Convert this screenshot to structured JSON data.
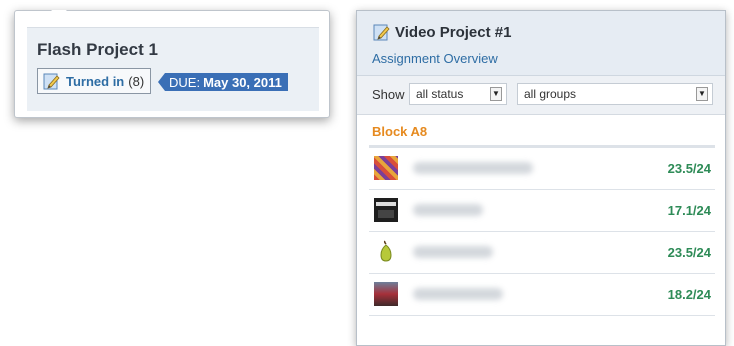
{
  "flash_card": {
    "title": "Flash Project 1",
    "turned_in_label": "Turned in",
    "turned_in_count": "(8)",
    "due_prefix": "DUE:",
    "due_date": "May 30, 2011",
    "icon": "edit-document-icon"
  },
  "assignment_panel": {
    "title": "Video Project #1",
    "subtitle": "Assignment Overview",
    "icon": "edit-document-icon",
    "filters": {
      "show_label": "Show",
      "status_value": "all status",
      "groups_value": "all groups"
    },
    "group_name": "Block A8",
    "students": [
      {
        "score": "23.5/24",
        "avatar": "colorful-avatar"
      },
      {
        "score": "17.1/24",
        "avatar": "dark-avatar"
      },
      {
        "score": "23.5/24",
        "avatar": "pear-avatar"
      },
      {
        "score": "18.2/24",
        "avatar": "photo-avatar"
      }
    ]
  },
  "colors": {
    "link_blue": "#2e6da4",
    "due_badge": "#3a6fb6",
    "group_orange": "#e68a1f",
    "score_green": "#2e8b57"
  }
}
